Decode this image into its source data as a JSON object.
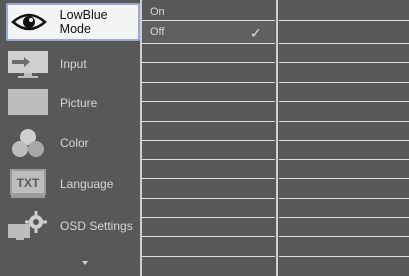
{
  "menu": {
    "items": [
      {
        "label": "LowBlue Mode",
        "icon": "eye-icon",
        "active": true
      },
      {
        "label": "Input",
        "icon": "input-icon",
        "active": false
      },
      {
        "label": "Picture",
        "icon": "picture-icon",
        "active": false
      },
      {
        "label": "Color",
        "icon": "color-icon",
        "active": false
      },
      {
        "label": "Language",
        "icon": "language-icon",
        "active": false
      },
      {
        "label": "OSD Settings",
        "icon": "osd-settings-icon",
        "active": false
      }
    ],
    "language_icon_text": "TXT",
    "scroll_icon": "chevron-down-icon"
  },
  "options": {
    "items": [
      {
        "label": "On",
        "selected": false
      },
      {
        "label": "Off",
        "selected": true
      }
    ],
    "check_glyph": "✓"
  },
  "colors": {
    "background": "#585858",
    "active_item_bg": "#f4f4f4",
    "active_item_border": "#9aa8d8",
    "text": "#d6d6d6"
  }
}
